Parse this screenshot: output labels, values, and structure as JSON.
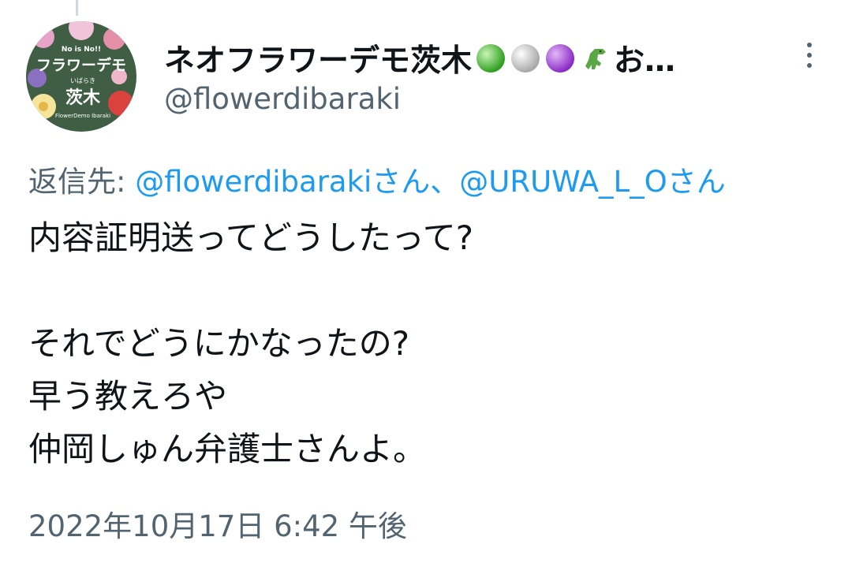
{
  "author": {
    "display_name": "ネオフラワーデモ茨木",
    "name_suffix": "お…",
    "emoji": [
      "green-circle",
      "white-circle",
      "purple-circle",
      "t-rex"
    ],
    "handle": "@flowerdibaraki",
    "avatar": {
      "banner_text": "No is No!!",
      "title": "フラワーデモ",
      "subtitle": "いばらき",
      "city": "茨木",
      "footer_text": "FlowerDemo Ibaraki",
      "bg_color": "#3f5e43"
    }
  },
  "reply": {
    "prefix": "返信先:",
    "mention1": "@flowerdibarakiさん",
    "separator": "、",
    "mention2": "@URUWA_L_Oさん"
  },
  "tweet": {
    "lines": [
      "内容証明送ってどうしたって?",
      "",
      "それでどうにかなったの?",
      "早う教えろや",
      "仲岡しゅん弁護士さんよ。"
    ]
  },
  "timestamp": "2022年10月17日 6:42 午後",
  "colors": {
    "link": "#1d9bf0",
    "secondary": "#536471",
    "text": "#0f1419"
  }
}
